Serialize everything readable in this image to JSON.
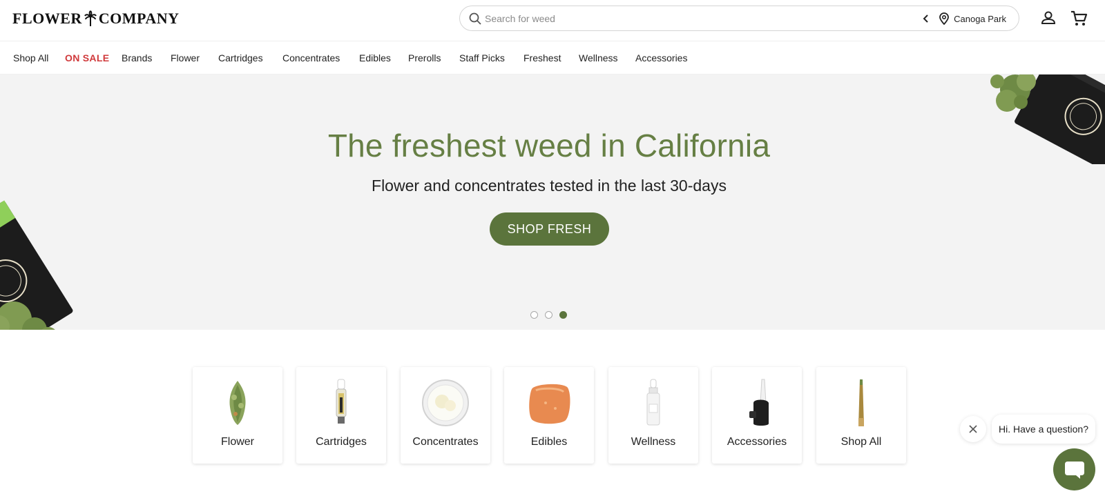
{
  "header": {
    "logo_left": "FLOWER",
    "logo_right": "COMPANY",
    "search_placeholder": "Search for weed",
    "location": "Canoga Park"
  },
  "nav": {
    "items": [
      {
        "label": "Shop All"
      },
      {
        "label": "ON SALE",
        "highlight": true
      },
      {
        "label": "Brands"
      },
      {
        "label": "Flower"
      },
      {
        "label": "Cartridges"
      },
      {
        "label": "Concentrates"
      },
      {
        "label": "Edibles"
      },
      {
        "label": "Prerolls"
      },
      {
        "label": "Staff Picks"
      },
      {
        "label": "Freshest"
      },
      {
        "label": "Wellness"
      },
      {
        "label": "Accessories"
      }
    ]
  },
  "hero": {
    "title": "The freshest weed in California",
    "subtitle": "Flower and concentrates tested in the last 30-days",
    "cta": "SHOP FRESH",
    "slide_count": 3,
    "active_slide": 3
  },
  "categories": [
    {
      "label": "Flower",
      "icon": "flower-bud-icon"
    },
    {
      "label": "Cartridges",
      "icon": "cartridge-icon"
    },
    {
      "label": "Concentrates",
      "icon": "concentrate-jar-icon"
    },
    {
      "label": "Edibles",
      "icon": "gummy-icon"
    },
    {
      "label": "Wellness",
      "icon": "tincture-bottle-icon"
    },
    {
      "label": "Accessories",
      "icon": "vaporizer-icon"
    },
    {
      "label": "Shop All",
      "icon": "preroll-icon"
    }
  ],
  "chat": {
    "greeting": "Hi. Have a question?"
  },
  "colors": {
    "brand_green": "#5b743c",
    "title_green": "#667f44",
    "sale_red": "#d0393b"
  }
}
